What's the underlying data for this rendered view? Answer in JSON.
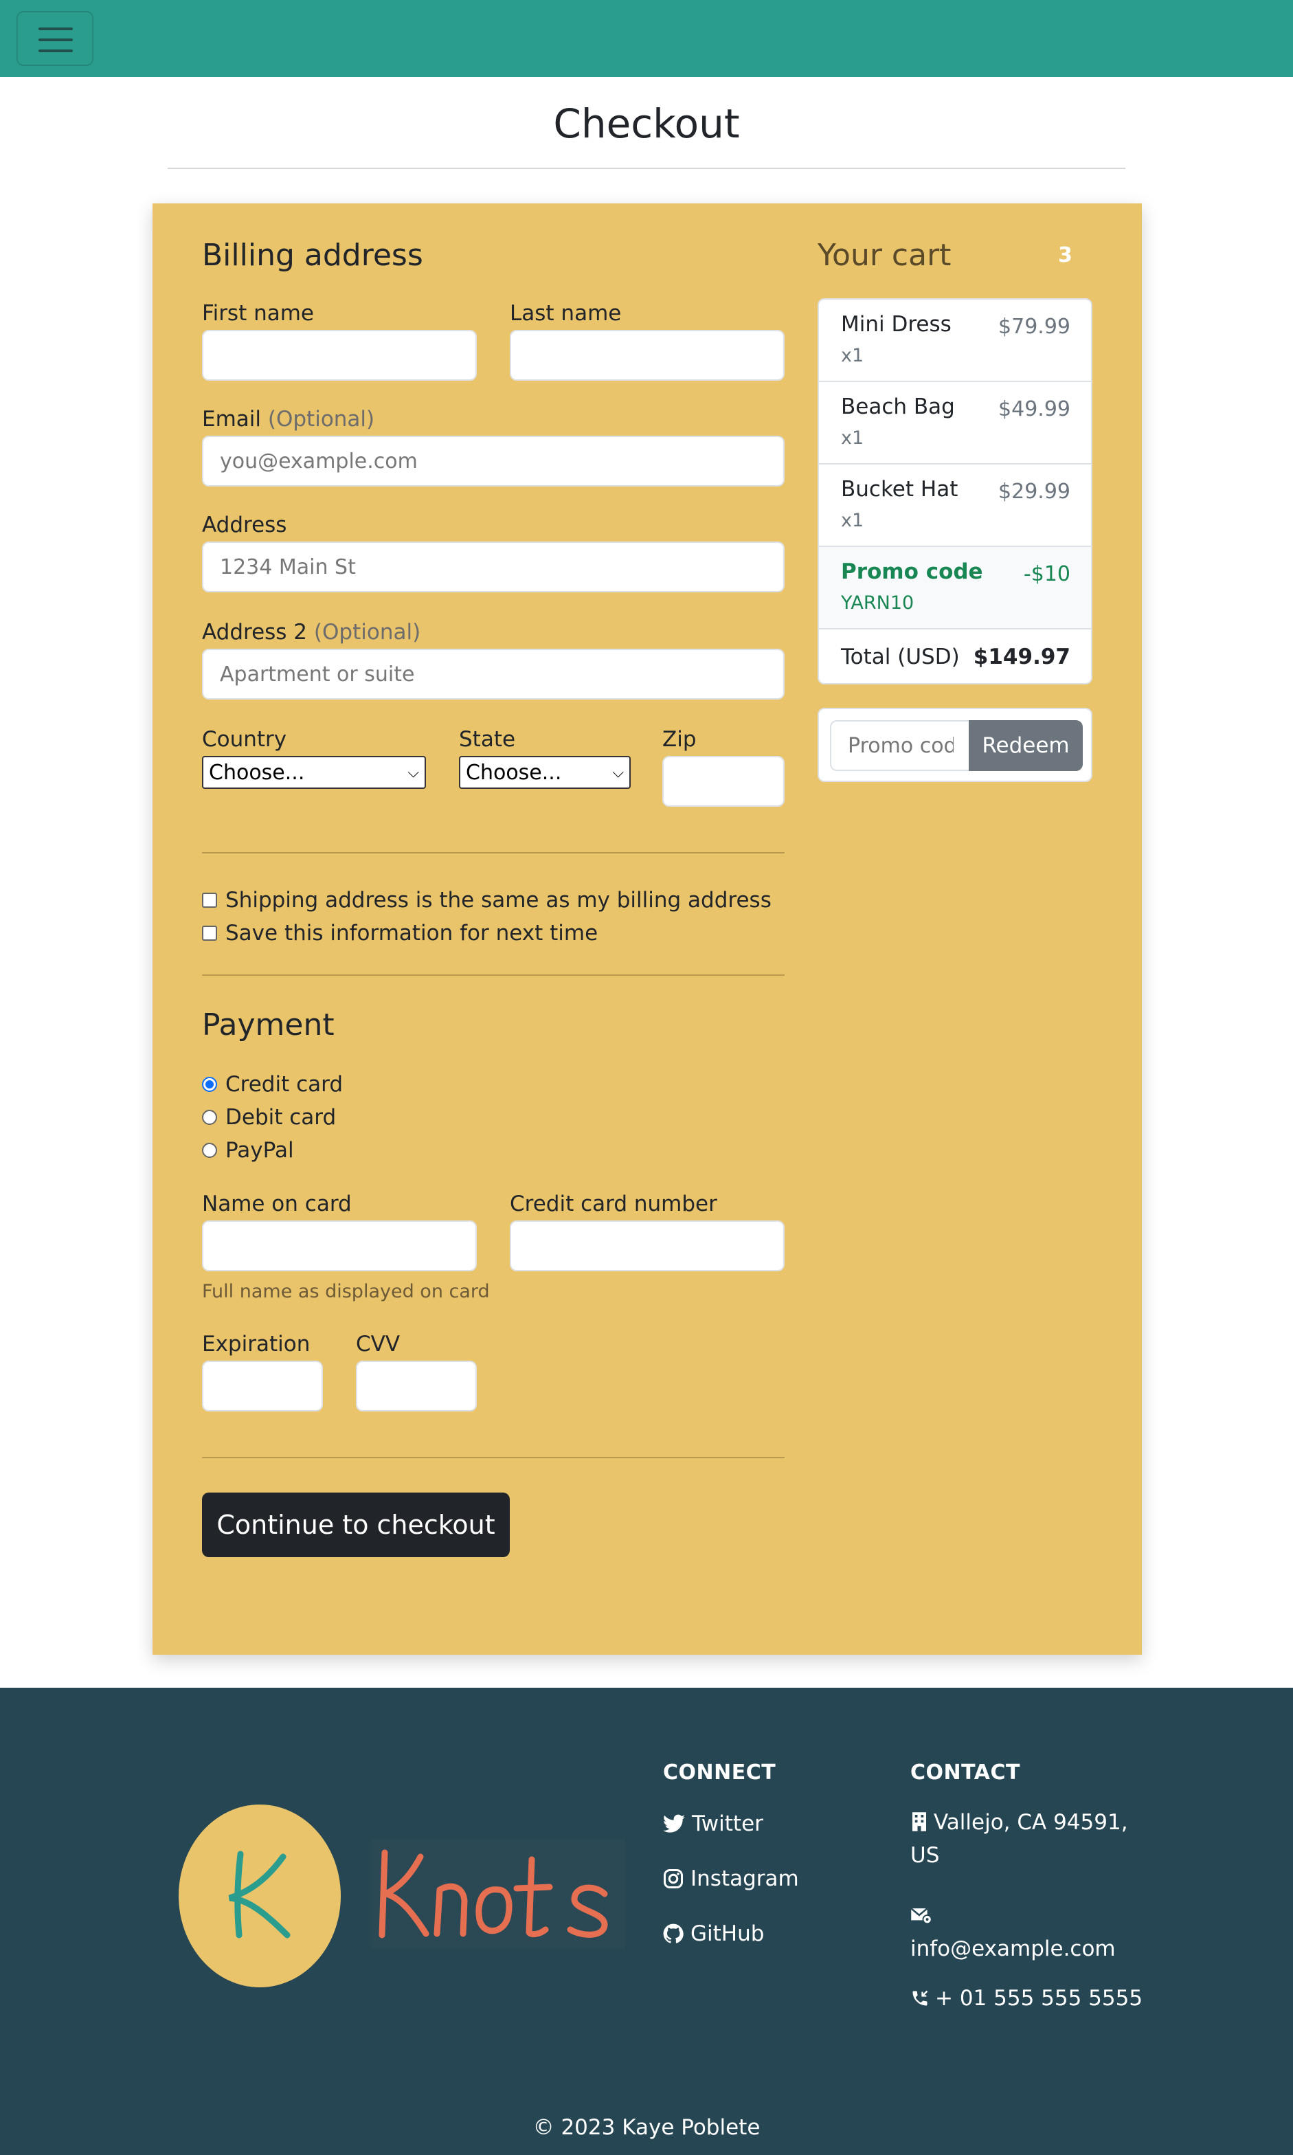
{
  "page": {
    "title": "Checkout"
  },
  "billing": {
    "heading": "Billing address",
    "first_name_label": "First name",
    "last_name_label": "Last name",
    "email_label": "Email",
    "optional": "(Optional)",
    "email_placeholder": "you@example.com",
    "address_label": "Address",
    "address_placeholder": "1234 Main St",
    "address2_label": "Address 2",
    "address2_placeholder": "Apartment or suite",
    "country_label": "Country",
    "country_value": "Choose...",
    "state_label": "State",
    "state_value": "Choose...",
    "zip_label": "Zip",
    "same_address_label": "Shipping address is the same as my billing address",
    "save_info_label": "Save this information for next time"
  },
  "payment": {
    "heading": "Payment",
    "methods": [
      {
        "label": "Credit card",
        "selected": true
      },
      {
        "label": "Debit card",
        "selected": false
      },
      {
        "label": "PayPal",
        "selected": false
      }
    ],
    "name_on_card_label": "Name on card",
    "name_help": "Full name as displayed on card",
    "card_number_label": "Credit card number",
    "expiration_label": "Expiration",
    "cvv_label": "CVV",
    "submit_label": "Continue to checkout"
  },
  "cart": {
    "title": "Your cart",
    "count": "3",
    "items": [
      {
        "name": "Mini Dress",
        "qty": "x1",
        "price": "$79.99"
      },
      {
        "name": "Beach Bag",
        "qty": "x1",
        "price": "$49.99"
      },
      {
        "name": "Bucket Hat",
        "qty": "x1",
        "price": "$29.99"
      }
    ],
    "promo": {
      "name": "Promo code",
      "code": "YARN10",
      "amount": "-$10"
    },
    "total_label": "Total (USD)",
    "total_value": "$149.97",
    "promo_placeholder": "Promo code",
    "redeem_label": "Redeem"
  },
  "footer": {
    "logo_letter": "K",
    "logo_word": "Knots",
    "connect_heading": "CONNECT",
    "links": [
      {
        "label": "Twitter",
        "icon": "twitter-icon"
      },
      {
        "label": "Instagram",
        "icon": "instagram-icon"
      },
      {
        "label": "GitHub",
        "icon": "github-icon"
      }
    ],
    "contact_heading": "CONTACT",
    "address_line1": "Vallejo, CA 94591,",
    "address_line2": "US",
    "email": "info@example.com",
    "phone": "+ 01 555 555 5555",
    "copyright": "© 2023 Kaye Poblete"
  },
  "colors": {
    "navbar": "#2a9d8f",
    "card": "#e9c46a",
    "footer": "#264653",
    "logo_text": "#e76f51",
    "promo_green": "#198754"
  }
}
